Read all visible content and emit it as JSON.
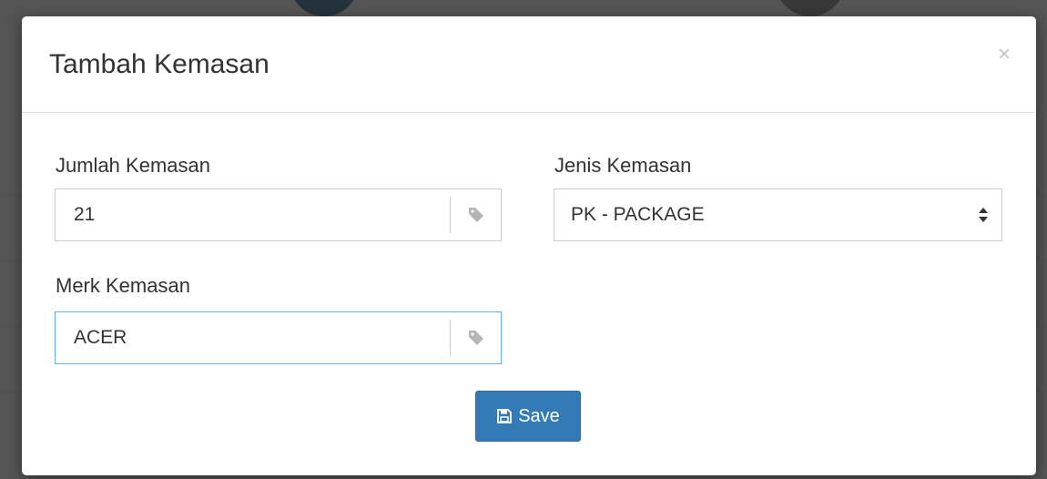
{
  "modal": {
    "title": "Tambah Kemasan",
    "close_label": "×"
  },
  "form": {
    "jumlah": {
      "label": "Jumlah Kemasan",
      "value": "21",
      "icon": "tag-icon"
    },
    "jenis": {
      "label": "Jenis Kemasan",
      "selected": "PK - PACKAGE",
      "icon": "sort-caret-icon"
    },
    "merk": {
      "label": "Merk Kemasan",
      "value": "ACER",
      "icon": "tag-icon"
    }
  },
  "actions": {
    "save_label": "Save",
    "save_icon": "floppy-disk-icon"
  },
  "colors": {
    "primary": "#337ab7",
    "focus_border": "#66afe9",
    "icon_gray": "#b5b5b5"
  }
}
